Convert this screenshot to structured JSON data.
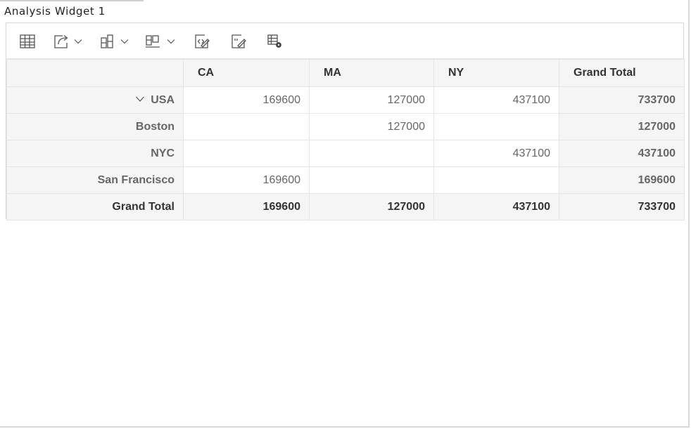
{
  "widget": {
    "title": "Analysis Widget 1"
  },
  "toolbar": {
    "buttons": [
      {
        "name": "grid-icon"
      },
      {
        "name": "export-icon"
      },
      {
        "name": "column-chart-icon"
      },
      {
        "name": "bar-chart-icon"
      },
      {
        "name": "formatting-icon"
      },
      {
        "name": "number-format-icon"
      },
      {
        "name": "field-list-icon"
      }
    ]
  },
  "pivot": {
    "columns": [
      "CA",
      "MA",
      "NY",
      "Grand Total"
    ],
    "rows": [
      {
        "label": "USA",
        "values": [
          "169600",
          "127000",
          "437100"
        ],
        "total": "733700"
      },
      {
        "label": "Boston",
        "values": [
          "",
          "127000",
          ""
        ],
        "total": "127000"
      },
      {
        "label": "NYC",
        "values": [
          "",
          "",
          "437100"
        ],
        "total": "437100"
      },
      {
        "label": "San Francisco",
        "values": [
          "169600",
          "",
          ""
        ],
        "total": "169600"
      }
    ],
    "grand_total": {
      "label": "Grand Total",
      "values": [
        "169600",
        "127000",
        "437100"
      ],
      "total": "733700"
    }
  }
}
